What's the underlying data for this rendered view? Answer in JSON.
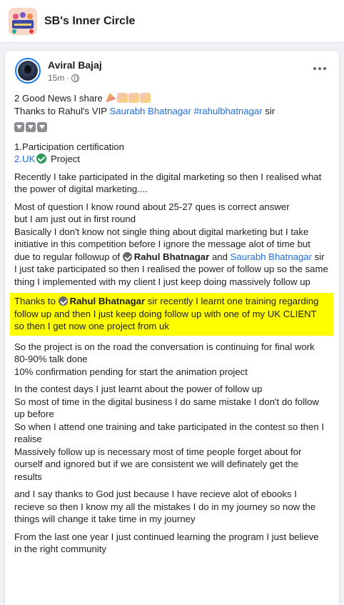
{
  "group": {
    "name": "SB's Inner Circle",
    "thumb_icon": "group-cover-icon"
  },
  "post": {
    "author": "Aviral Bajaj",
    "time": "15m",
    "dot": "·",
    "privacy_icon": "globe-icon",
    "more_icon": "more-options-icon",
    "line1": "2 Good News I share",
    "line2_prefix": "Thanks to Rahul's VIP ",
    "line2_link": "Saurabh Bhatnagar",
    "line2_hashtag": "#rahulbhatnagar",
    "line2_suffix": " sir",
    "list1": "1.Participation certification",
    "list2_link": "2.UK",
    "list2_suffix": " Project",
    "para1": "Recently I take participated in the digital marketing so then I realised what the power of digital marketing....",
    "para2a": "Most of question I know round about 25-27 ques is correct answer",
    "para2b": "but I am just out in first round",
    "para2c_prefix": "Basically I don't know not single thing about digital marketing but I take initiative in this competition before I ignore the message alot of time but due to regular followup of ",
    "para2c_mention": "Rahul Bhatnagar",
    "para2c_mid": "  and ",
    "para2c_link": "Saurabh Bhatnagar",
    "para2c_suffix": " sir I just take participated so then I realised the power of follow up so the same thing I implemented with my client I just keep doing massively follow up",
    "hl_prefix": "Thanks to ",
    "hl_mention": "Rahul Bhatnagar",
    "hl_suffix": "   sir recently I learnt one training regarding follow up and then I just keep doing follow up with one of my UK CLIENT so then I get now one project from uk",
    "para4a": "So the project is on the road the conversation is continuing for final work",
    "para4b": "80-90% talk done",
    "para4c": "10% confirmation pending for start the animation project",
    "para5a": "In the contest days I just learnt about the power of follow up",
    "para5b": "So most of time in the digital business I do same mistake I don't do follow up before",
    "para5c": "So when I attend one training and take participated in the contest so then I realise",
    "para5d": "Massively follow up is necessary most of time people forget about for ourself and ignored but if we are consistent we will definately get the results",
    "para6": "and I say thanks to God just because I have recieve alot of ebooks I recieve so then I know my all the mistakes I do in my journey so now the things will change it take time in my journey",
    "para7": "From the last one year I just continued learning the program I just believe in the right community"
  },
  "colors": {
    "link": "#216fdb",
    "highlight": "#ffff00",
    "verified": "#2e9b58"
  }
}
